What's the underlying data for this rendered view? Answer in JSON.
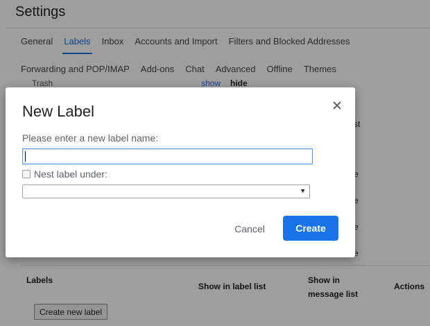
{
  "page": {
    "title": "Settings",
    "tabs_row1": [
      "General",
      "Labels",
      "Inbox",
      "Accounts and Import",
      "Filters and Blocked Addresses"
    ],
    "tabs_row2": [
      "Forwarding and POP/IMAP",
      "Add-ons",
      "Chat",
      "Advanced",
      "Offline",
      "Themes"
    ],
    "active_tab": "Labels",
    "system_label_partial": "Trash",
    "system_show": "show",
    "system_hide": "hide",
    "peek_text": [
      "st",
      "e",
      "e",
      "e",
      "e"
    ]
  },
  "labels_table": {
    "col_labels": "Labels",
    "col_show_in_label_list": "Show in label list",
    "col_show_in_message_list": "Show in message list",
    "col_actions": "Actions",
    "create_button": "Create new label"
  },
  "dialog": {
    "title": "New Label",
    "close_glyph": "×",
    "name_prompt": "Please enter a new label name:",
    "name_value": "",
    "nest_label": "Nest label under:",
    "nest_checked": false,
    "nest_selected": "",
    "cancel_label": "Cancel",
    "create_label": "Create"
  },
  "colors": {
    "accent": "#1a73e8",
    "focus_border": "#4d90fe",
    "scrim": "rgba(0,0,0,0.38)"
  }
}
